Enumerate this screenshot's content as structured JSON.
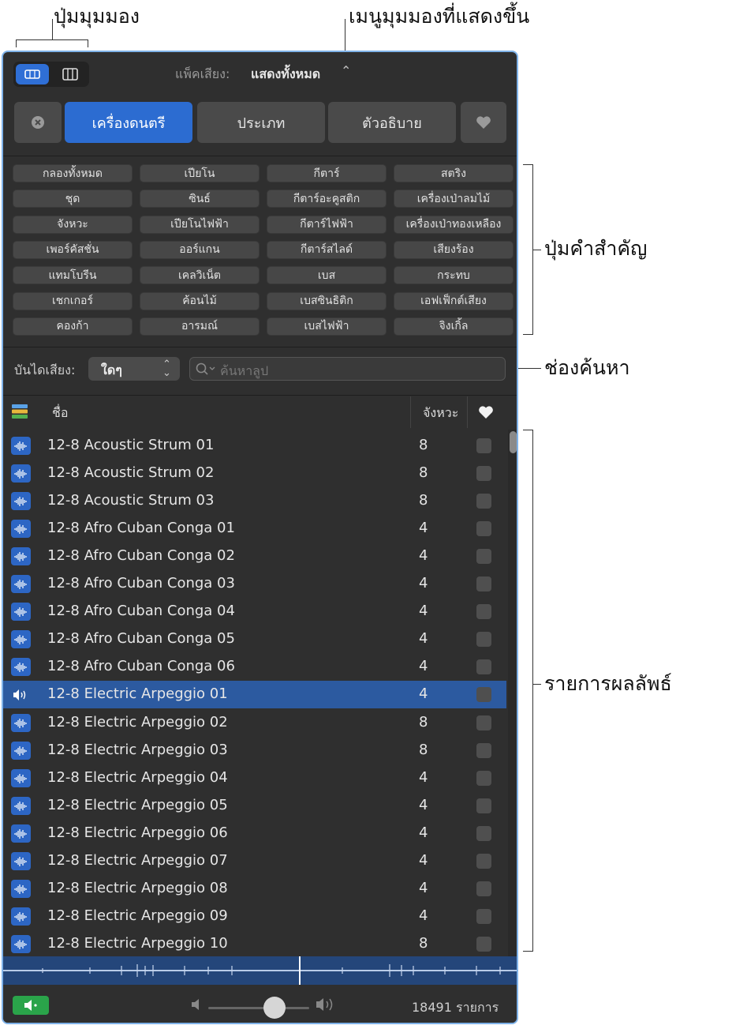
{
  "callouts": {
    "view_buttons": "ปุ่มมุมมอง",
    "view_menu": "เมนูมุมมองที่แสดงขึ้น",
    "keyword_buttons": "ปุ่มคำสำคัญ",
    "search_field": "ช่องค้นหา",
    "results_list": "รายการผลลัพธ์"
  },
  "toolbar": {
    "pack_label": "แพ็คเสียง:",
    "pack_value": "แสดงทั้งหมด"
  },
  "segments": {
    "instrument": "เครื่องดนตรี",
    "genre": "ประเภท",
    "descriptor": "ตัวอธิบาย"
  },
  "keywords": [
    [
      "กลองทั้งหมด",
      "เปียโน",
      "กีตาร์",
      "สตริง"
    ],
    [
      "ชุด",
      "ซินธ์",
      "กีตาร์อะคูสติก",
      "เครื่องเป่าลมไม้"
    ],
    [
      "จังหวะ",
      "เปียโนไฟฟ้า",
      "กีตาร์ไฟฟ้า",
      "เครื่องเป่าทองเหลือง"
    ],
    [
      "เพอร์คัสชั่น",
      "ออร์แกน",
      "กีตาร์สไลด์",
      "เสียงร้อง"
    ],
    [
      "แทมโบรีน",
      "เคลวิเน็ต",
      "เบส",
      "กระทบ"
    ],
    [
      "เชกเกอร์",
      "ค้อนไม้",
      "เบสซินธิติก",
      "เอฟเฟ็กต์เสียง"
    ],
    [
      "คองก้า",
      "อารมณ์",
      "เบสไฟฟ้า",
      "จิงเกิ้ล"
    ]
  ],
  "filter": {
    "scale_label": "บันไดเสียง:",
    "scale_value": "ใดๆ",
    "search_placeholder": "ค้นหาลูป"
  },
  "columns": {
    "name": "ชื่อ",
    "beats": "จังหวะ"
  },
  "results": [
    {
      "name": "12-8 Acoustic Strum 01",
      "beats": "8"
    },
    {
      "name": "12-8 Acoustic Strum 02",
      "beats": "8"
    },
    {
      "name": "12-8 Acoustic Strum 03",
      "beats": "8"
    },
    {
      "name": "12-8 Afro Cuban Conga 01",
      "beats": "4"
    },
    {
      "name": "12-8 Afro Cuban Conga 02",
      "beats": "4"
    },
    {
      "name": "12-8 Afro Cuban Conga 03",
      "beats": "4"
    },
    {
      "name": "12-8 Afro Cuban Conga 04",
      "beats": "4"
    },
    {
      "name": "12-8 Afro Cuban Conga 05",
      "beats": "4"
    },
    {
      "name": "12-8 Afro Cuban Conga 06",
      "beats": "4"
    },
    {
      "name": "12-8 Electric Arpeggio 01",
      "beats": "4",
      "selected": true
    },
    {
      "name": "12-8 Electric Arpeggio 02",
      "beats": "8"
    },
    {
      "name": "12-8 Electric Arpeggio 03",
      "beats": "8"
    },
    {
      "name": "12-8 Electric Arpeggio 04",
      "beats": "4"
    },
    {
      "name": "12-8 Electric Arpeggio 05",
      "beats": "4"
    },
    {
      "name": "12-8 Electric Arpeggio 06",
      "beats": "4"
    },
    {
      "name": "12-8 Electric Arpeggio 07",
      "beats": "4"
    },
    {
      "name": "12-8 Electric Arpeggio 08",
      "beats": "4"
    },
    {
      "name": "12-8 Electric Arpeggio 09",
      "beats": "4"
    },
    {
      "name": "12-8 Electric Arpeggio 10",
      "beats": "8"
    }
  ],
  "footer": {
    "count": "18491",
    "count_unit": "รายการ"
  },
  "colors": {
    "accent": "#2c6cd1",
    "panel": "#2f2f2f",
    "selected_row": "#2c5aa0",
    "border": "#7fb2e8",
    "speaker": "#2aa44a"
  }
}
